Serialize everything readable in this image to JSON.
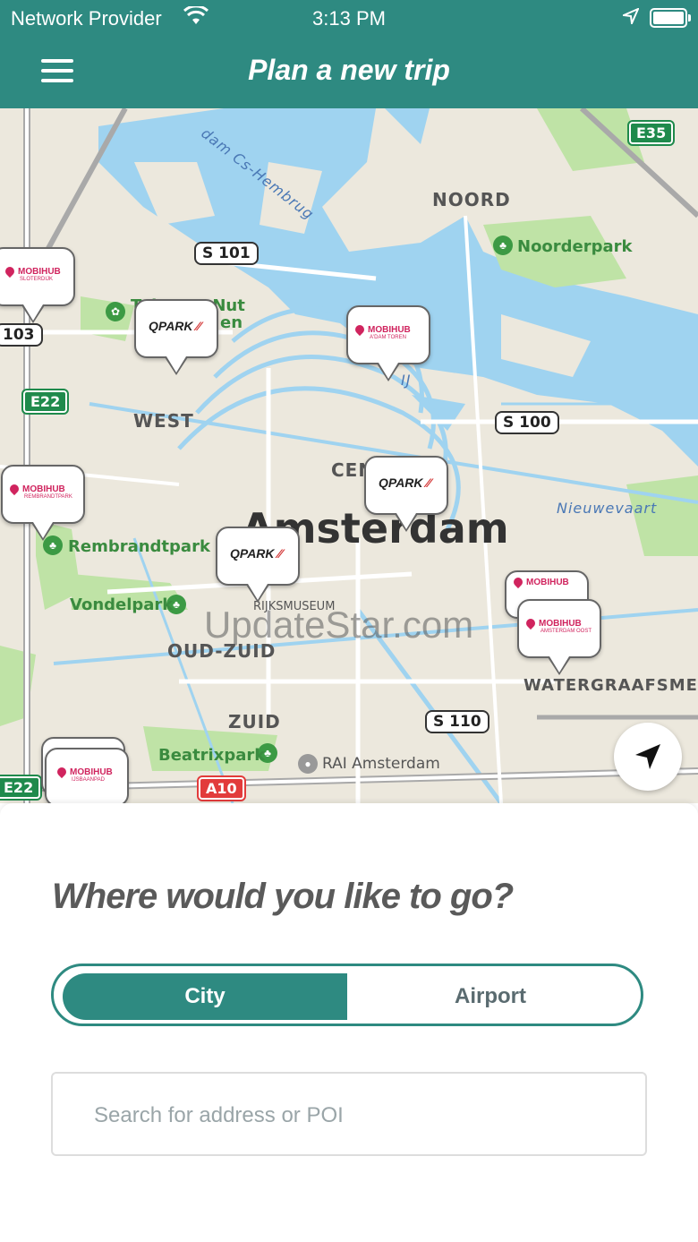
{
  "status_bar": {
    "provider": "Network Provider",
    "time": "3:13 PM"
  },
  "header": {
    "title": "Plan a new trip"
  },
  "map": {
    "city_label": "Amsterdam",
    "districts": [
      "NOORD",
      "WEST",
      "CEN",
      "OUD-ZUID",
      "ZUID",
      "WATERGRAAFSMEER"
    ],
    "parks": [
      "Noorderpark",
      "Rembrandtpark",
      "Vondelpark",
      "Beatrixpark"
    ],
    "pois": [
      "RIJKSMUSEUM",
      "RAI Amsterdam",
      "Tuin van Nut",
      "en"
    ],
    "water_labels": [
      "dam Cs-Hembrug",
      "IJ",
      "Nieuwevaart"
    ],
    "road_signs": [
      "S 101",
      "103",
      "S 100",
      "S 110"
    ],
    "e_signs": [
      "E35",
      "E22",
      "E22"
    ],
    "a_signs": [
      "A10"
    ],
    "watermark": "UpdateStar.com",
    "markers": {
      "mobihub_label": "MOBIHUB",
      "mobihub_sloterdijk": "SLOTERDIJK",
      "mobihub_adam_toren": "A'DAM TOREN",
      "mobihub_rembrandtpark": "REMBRANDTPARK",
      "mobihub_amsterdam_oost": "AMSTERDAM OOST",
      "mobihub_ijsbaanpad": "IJSBAANPAD",
      "qpark_label": "PARK",
      "qpark_q": "Q"
    }
  },
  "sheet": {
    "question": "Where would you like to go?",
    "segments": {
      "city": "City",
      "airport": "Airport",
      "selected": "City"
    },
    "search": {
      "placeholder": "Search for address or POI",
      "value": ""
    }
  },
  "colors": {
    "brand": "#2e8a81",
    "mobihub": "#d0245e",
    "water": "#9fd3f0",
    "park": "#bfe3a6"
  }
}
